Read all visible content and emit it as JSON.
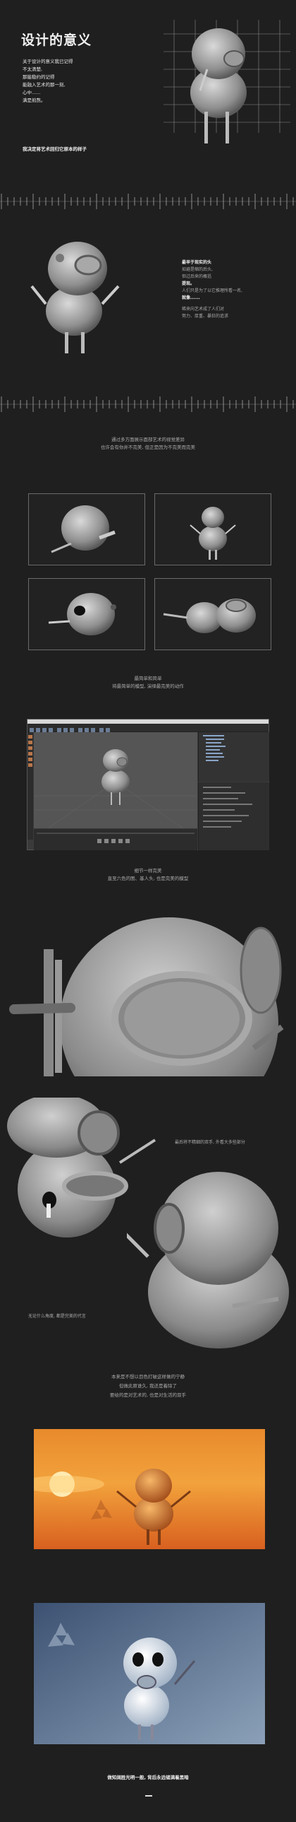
{
  "hero": {
    "title": "设计的意义",
    "lines": [
      "关于设计的意义我已记得",
      "不太清楚,",
      "那能稳约的记得",
      "能融入艺术的那一刻,",
      "心中......",
      "满是煎熬。"
    ],
    "tagline": "我决定将艺术回归它原本的样子"
  },
  "section2": {
    "heading": "最早于现实的头",
    "lines": [
      "如避是缩的后头,",
      "但过后来的概括",
      "提现。",
      "人们只是为了以它推理所看一名,",
      "就像......",
      "稀来向艺术成了人们对",
      "努力、厚重、暴狂的追求"
    ]
  },
  "section3": {
    "lines": [
      "通过多方面展示面部艺术的视觉差异",
      "也许会有你并不完美, 但正是因为不完美而完美"
    ]
  },
  "section4": {
    "lines": [
      "最简单和简单",
      "将最简单的模型, 演绎最完美的动作"
    ]
  },
  "section5": {
    "lines": [
      "细节一样完美",
      "直至六色的图、基人头, 也是完美的模型"
    ]
  },
  "section6": {
    "caption_right": "最后将不精细的双手, 外看大多些部分",
    "caption_left": "无论什么角度, 都是完美的代言"
  },
  "section7": {
    "lines": [
      "本来是不想以目色打破这样做的宁静",
      "但做此原谁久, 我还是着除了",
      "要给的是对艺术的, 也是对生活的双手"
    ]
  },
  "footer": {
    "tagline": "做知阔胜光明一般, 背后永远储满着黑暗"
  },
  "colors": {
    "background": "#1f1f1f",
    "sunset_top": "#f2a23c",
    "sunset_bottom": "#d85a22",
    "blue_top": "#3d5272",
    "blue_bottom": "#8ba0b8"
  }
}
